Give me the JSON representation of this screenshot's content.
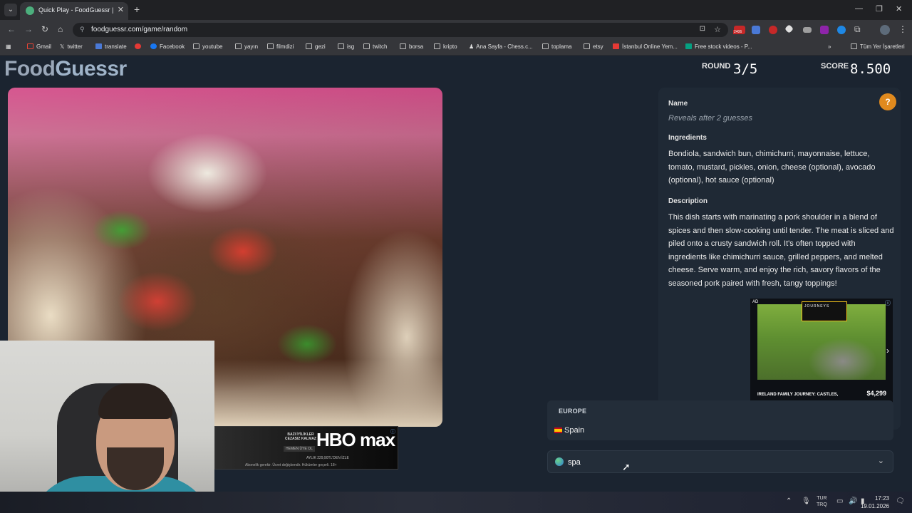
{
  "browser": {
    "tab_title": "Quick Play - FoodGuessr | Food",
    "url": "foodguessr.com/game/random",
    "bookmarks": [
      "Gmail",
      "twitter",
      "translate",
      "Facebook",
      "youtube",
      "yayın",
      "filmdizi",
      "gezi",
      "isg",
      "twitch",
      "borsa",
      "kripto",
      "Ana Sayfa - Chess.c...",
      "toplama",
      "etsy",
      "İstanbul Online Yem...",
      "Free stock videos - P..."
    ],
    "bookmarks_all": "Tüm Yer İşaretleri",
    "ext_badge": "2406"
  },
  "game": {
    "logo_part1": "Food",
    "logo_part2": "Guessr",
    "round_label": "ROUND",
    "round_value": "3/5",
    "score_label": "SCORE",
    "score_value": "8.500"
  },
  "clues": {
    "name_label": "Name",
    "name_value": "Reveals after 2 guesses",
    "ingredients_label": "Ingredients",
    "ingredients_value": "Bondiola, sandwich bun, chimichurri, mayonnaise, lettuce, tomato, mustard, pickles, onion, cheese (optional), avocado (optional), hot sauce (optional)",
    "description_label": "Description",
    "description_value": "This dish starts with marinating a pork shoulder in a blend of spices and then slow-cooking until tender. The meat is sliced and piled onto a crusty sandwich roll. It's often topped with ingredients like chimichurri sauce, grilled peppers, and melted cheese. Serve warm, and enjoy the rich, savory flavors of the seasoned pork paired with fresh, tangy toppings!"
  },
  "guess": {
    "region_label": "EUROPE",
    "option_label": "Spain",
    "input_value": "spa"
  },
  "ads": {
    "right_ad_label": "AD",
    "right_caption": "IRELAND FAMILY JOURNEY: CASTLES,",
    "right_price": "$4,299",
    "right_brand": "JOURNEYS",
    "bottom_t1": "BAZI İYİLİKLER CEZASIZ KALMAZ",
    "bottom_t2": "HEMEN ÜYE OL",
    "bottom_brand": "HBO max",
    "bottom_t3": "AYLIK 229,90TL'DEN İZLE",
    "bottom_t4": "Abonelik gerekir. Ücret değişkendir. Hükümler geçerli. 18+"
  },
  "taskbar": {
    "lang_top": "TUR",
    "lang_bottom": "TRQ",
    "time": "17:23",
    "date": "19.01.2026"
  }
}
